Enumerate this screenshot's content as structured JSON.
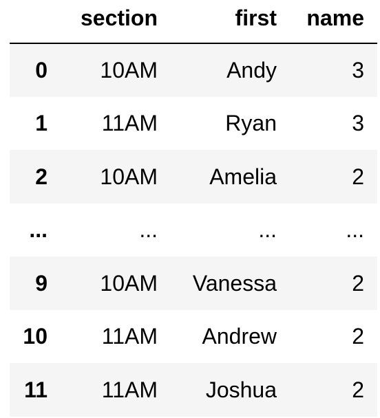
{
  "table": {
    "index_header": "",
    "columns": [
      "section",
      "first",
      "name"
    ],
    "rows": [
      {
        "index": "0",
        "section": "10AM",
        "first": "Andy",
        "name": "3"
      },
      {
        "index": "1",
        "section": "11AM",
        "first": "Ryan",
        "name": "3"
      },
      {
        "index": "2",
        "section": "10AM",
        "first": "Amelia",
        "name": "2"
      },
      {
        "index": "...",
        "section": "...",
        "first": "...",
        "name": "..."
      },
      {
        "index": "9",
        "section": "10AM",
        "first": "Vanessa",
        "name": "2"
      },
      {
        "index": "10",
        "section": "11AM",
        "first": "Andrew",
        "name": "2"
      },
      {
        "index": "11",
        "section": "11AM",
        "first": "Joshua",
        "name": "2"
      }
    ]
  },
  "colors": {
    "row_shade": "#f5f5f5",
    "text": "#000000",
    "header_rule": "#000000"
  }
}
